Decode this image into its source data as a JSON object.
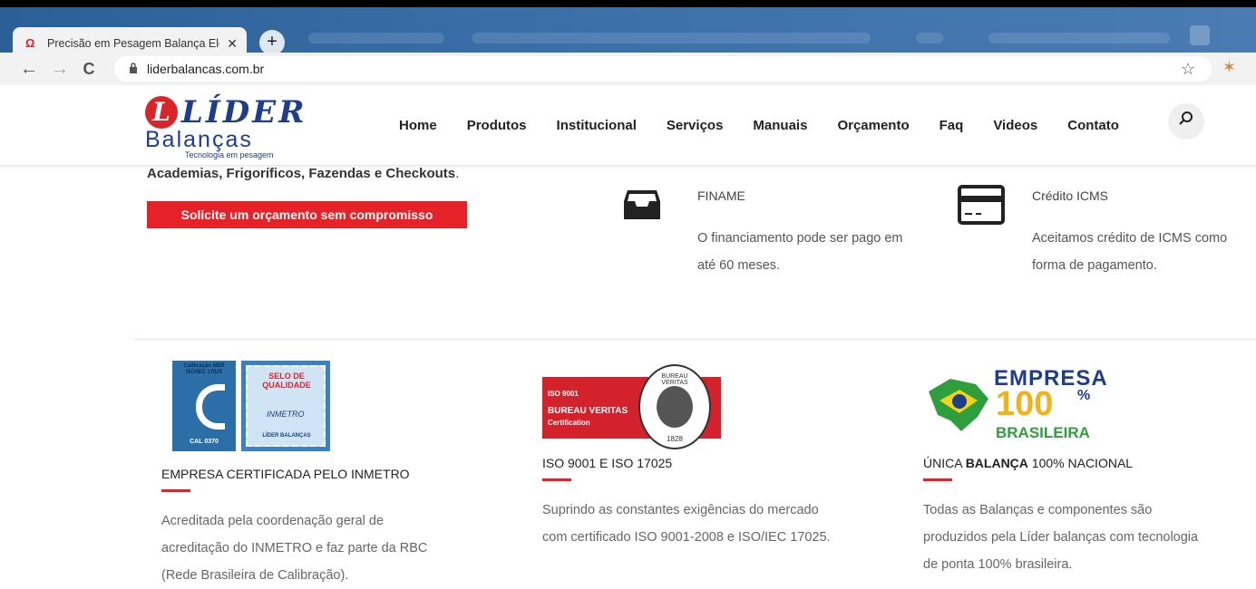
{
  "browser": {
    "tab_title": "Precisão em Pesagem Balança Ele",
    "tab_close": "✕",
    "new_tab": "+",
    "back": "←",
    "forward": "→",
    "reload": "C",
    "url": "liderbalancas.com.br"
  },
  "site": {
    "logo": {
      "mark": "L",
      "word": "LÍDER",
      "sub": "Balanças",
      "tagline": "Tecnologia em pesagem"
    },
    "menu": [
      "Home",
      "Produtos",
      "Institucional",
      "Serviços",
      "Manuais",
      "Orçamento",
      "Faq",
      "Videos",
      "Contato"
    ]
  },
  "intro": {
    "text": "Academias, Frigoríficos, Fazendas e Checkouts",
    "dot": ".",
    "cta": "Solicite um orçamento sem compromisso"
  },
  "features": [
    {
      "icon": "inbox-icon",
      "title": "FINAME",
      "line1": "O financiamento pode ser pago em",
      "line2": "até 60 meses."
    },
    {
      "icon": "credit-card-icon",
      "title": "Crédito ICMS",
      "line1": "Aceitamos crédito de ICMS como",
      "line2": "forma de pagamento."
    }
  ],
  "certs": [
    {
      "title": "EMPRESA CERTIFICADA PELO INMETRO",
      "line1": "Acreditada pela coordenação geral de",
      "line2": "acreditação do INMETRO e faz parte da RBC",
      "line3": "(Rede Brasileira de Calibração).",
      "badge1": {
        "top": "Calibração NBR ISO/IEC 17025",
        "bottom": "CAL 0370"
      },
      "badge2": {
        "top": "SELO DE QUALIDADE",
        "brand": "INMETRO",
        "bottom": "LÍDER BALANÇAS"
      }
    },
    {
      "title": "ISO 9001 E ISO 17025",
      "line1": "Suprindo as constantes exigências do mercado",
      "line2": "com certificado ISO 9001-2008 e ISO/IEC 17025.",
      "badge": {
        "l1": "ISO 9001",
        "l2": "BUREAU VERITAS",
        "l3": "Certification",
        "ring": "BUREAU VERITAS",
        "year": "1828"
      }
    },
    {
      "title_pre": "ÚNICA ",
      "title_bold": "BALANÇA",
      "title_post": " 100% NACIONAL",
      "line1": "Todas as Balanças e componentes são",
      "line2": "produzidos pela Líder balanças com tecnologia",
      "line3": "de ponta 100% brasileira.",
      "badge": {
        "l1": "EMPRESA",
        "num": "100",
        "pct": "%",
        "l3": "BRASILEIRA"
      }
    }
  ],
  "colors": {
    "accent": "#e52228",
    "brand_blue": "#1e3d8b"
  }
}
